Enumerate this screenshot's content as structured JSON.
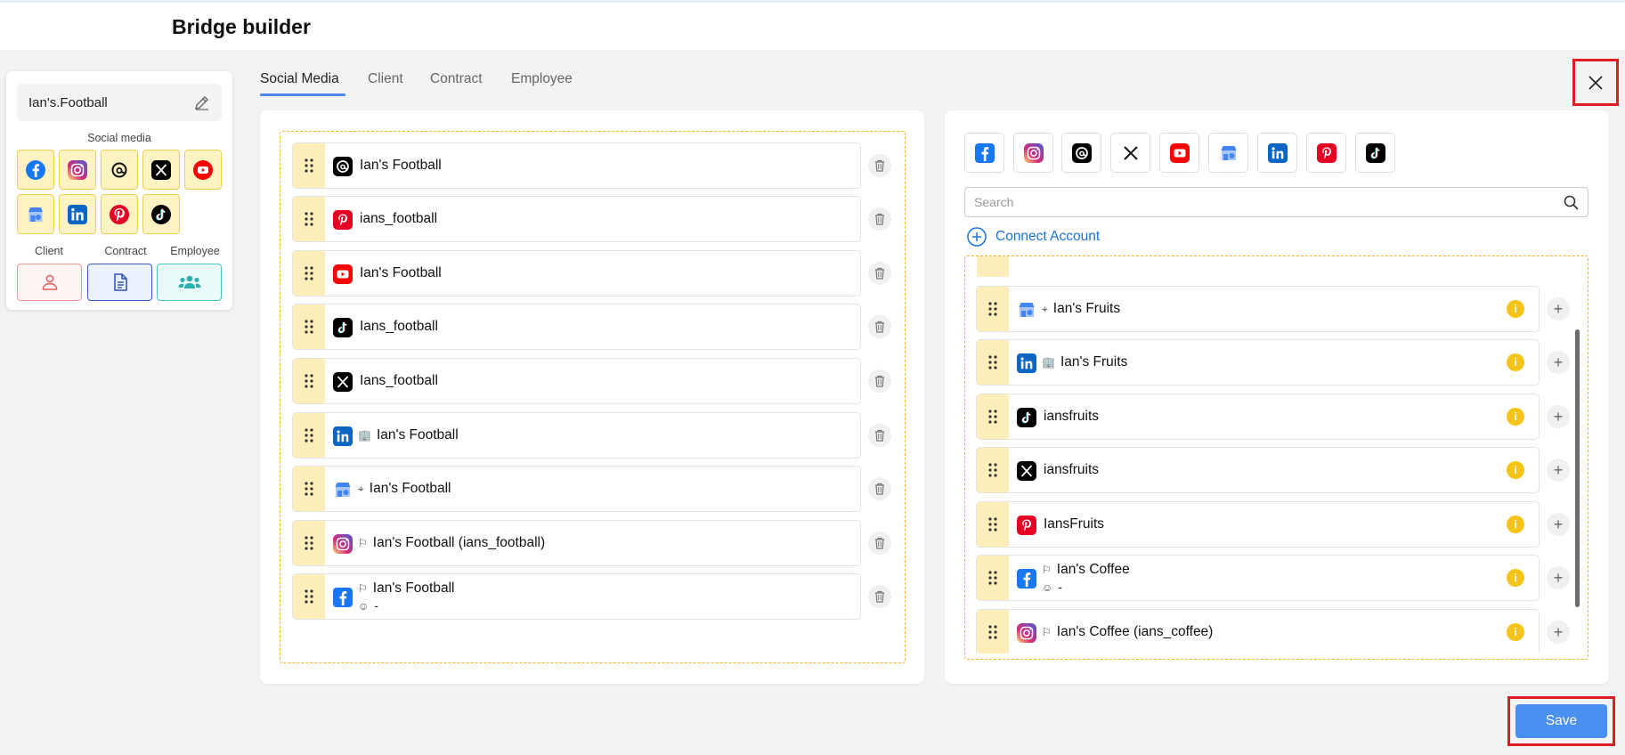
{
  "page": {
    "title": "Bridge builder"
  },
  "summary": {
    "name": "Ian's.Football",
    "social_label": "Social media",
    "client_label": "Client",
    "contract_label": "Contract",
    "employee_label": "Employee"
  },
  "tabs": [
    {
      "label": "Social Media",
      "active": true
    },
    {
      "label": "Client"
    },
    {
      "label": "Contract"
    },
    {
      "label": "Employee"
    }
  ],
  "selected_accounts": [
    {
      "platform": "threads",
      "name": "Ian's Football"
    },
    {
      "platform": "pinterest",
      "name": "ians_football"
    },
    {
      "platform": "youtube",
      "name": "Ian's Football"
    },
    {
      "platform": "tiktok",
      "name": "Ians_football"
    },
    {
      "platform": "x",
      "name": "Ians_football"
    },
    {
      "platform": "linkedin",
      "name": "Ian's Football",
      "tag_icon": "building-icon"
    },
    {
      "platform": "google-business",
      "name": "Ian's Football",
      "tag_icon": "location-pin-icon"
    },
    {
      "platform": "instagram",
      "name": "Ian's Football (ians_football)",
      "tag_icon": "flag-icon"
    },
    {
      "platform": "facebook",
      "name": "Ian's Football",
      "tag_icon": "flag-icon",
      "sub": "-",
      "sub_icon": "user-circle-icon"
    }
  ],
  "available": {
    "search_placeholder": "Search",
    "connect_label": "Connect Account",
    "accounts": [
      {
        "platform": "google-business",
        "name": "Ian's Fruits",
        "tag_icon": "location-pin-icon"
      },
      {
        "platform": "linkedin",
        "name": "Ian's Fruits",
        "tag_icon": "building-icon"
      },
      {
        "platform": "tiktok",
        "name": "iansfruits"
      },
      {
        "platform": "x",
        "name": "iansfruits"
      },
      {
        "platform": "pinterest",
        "name": "IansFruits"
      },
      {
        "platform": "facebook",
        "name": "Ian's Coffee",
        "tag_icon": "flag-icon",
        "sub": "-",
        "sub_icon": "user-circle-icon"
      },
      {
        "platform": "instagram",
        "name": "Ian's Coffee (ians_coffee)",
        "tag_icon": "flag-icon"
      }
    ]
  },
  "actions": {
    "save_label": "Save"
  },
  "colors": {
    "accent": "#4a90f0",
    "tile_bg": "#fff3c4",
    "grip_bg": "#fdeeba",
    "dashed_border": "#f0b429",
    "highlight": "#e01b24"
  }
}
